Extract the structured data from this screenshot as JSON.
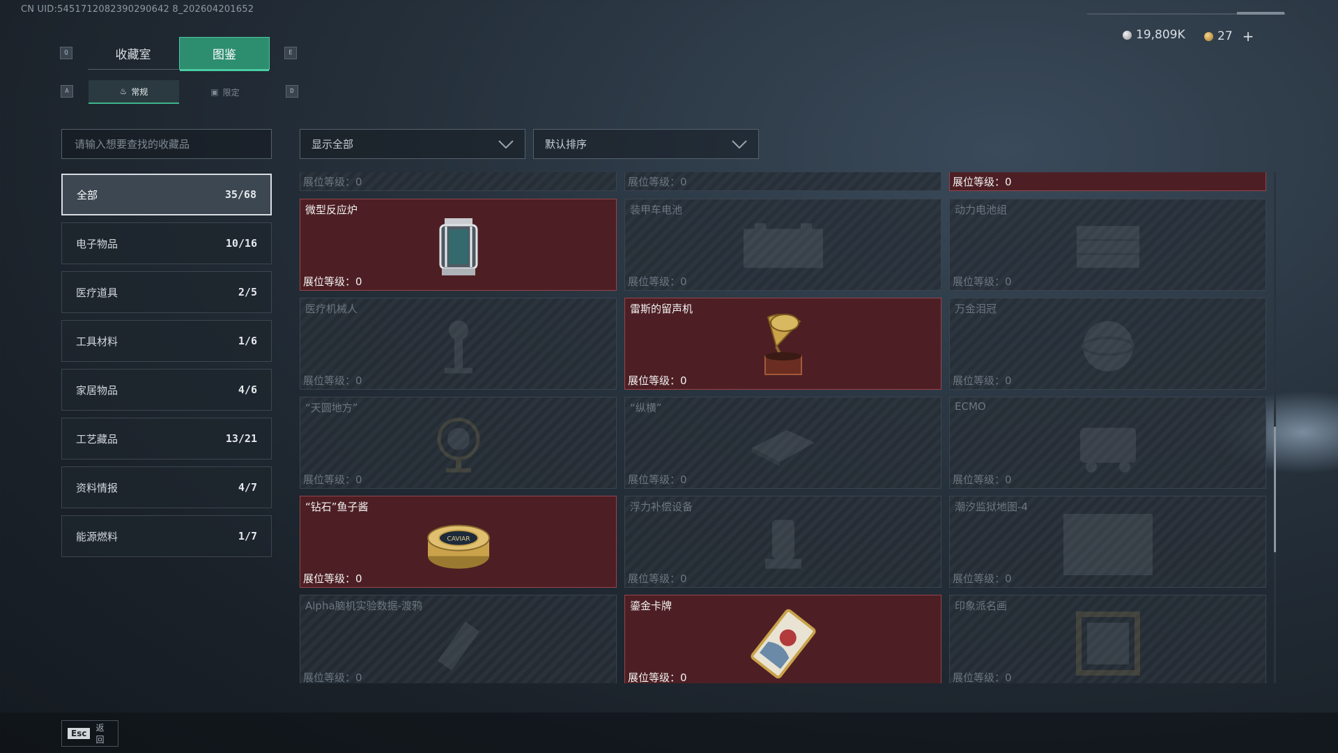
{
  "header": {
    "uid": "CN UID:5451712082390290642 8_202604201652",
    "keys": {
      "left_main": "Q",
      "right_main": "E",
      "left_sub": "A",
      "right_sub": "D"
    },
    "tabs": [
      {
        "label": "收藏室"
      },
      {
        "label": "图鉴"
      }
    ],
    "subtabs": [
      {
        "label": "常规"
      },
      {
        "label": "限定"
      }
    ],
    "currency": {
      "silver": "19,809K",
      "gold": "27"
    }
  },
  "search": {
    "placeholder": "请输入想要查找的收藏品"
  },
  "filters": {
    "show": "显示全部",
    "sort": "默认排序"
  },
  "categories": [
    {
      "label": "全部",
      "count": "35/68"
    },
    {
      "label": "电子物品",
      "count": "10/16"
    },
    {
      "label": "医疗道具",
      "count": "2/5"
    },
    {
      "label": "工具材料",
      "count": "1/6"
    },
    {
      "label": "家居物品",
      "count": "4/6"
    },
    {
      "label": "工艺藏品",
      "count": "13/21"
    },
    {
      "label": "资料情报",
      "count": "4/7"
    },
    {
      "label": "能源燃料",
      "count": "1/7"
    }
  ],
  "level_label": "展位等级：0",
  "items": [
    {
      "name": "",
      "owned": false,
      "icon": "none"
    },
    {
      "name": "",
      "owned": false,
      "icon": "none"
    },
    {
      "name": "",
      "owned": true,
      "icon": "none"
    },
    {
      "name": "微型反应炉",
      "owned": true,
      "icon": "reactor-icon"
    },
    {
      "name": "装甲车电池",
      "owned": false,
      "icon": "battery-icon"
    },
    {
      "name": "动力电池组",
      "owned": false,
      "icon": "battery-pack-icon"
    },
    {
      "name": "医疗机械人",
      "owned": false,
      "icon": "robot-icon"
    },
    {
      "name": "雷斯的留声机",
      "owned": true,
      "icon": "gramophone-icon"
    },
    {
      "name": "万金泪冠",
      "owned": false,
      "icon": "crown-icon"
    },
    {
      "name": "“天圆地方”",
      "owned": false,
      "icon": "globe-icon"
    },
    {
      "name": "“纵横”",
      "owned": false,
      "icon": "chessboard-icon"
    },
    {
      "name": "ECMO",
      "owned": false,
      "icon": "ecmo-icon"
    },
    {
      "name": "“钻石”鱼子酱",
      "owned": true,
      "icon": "caviar-icon"
    },
    {
      "name": "浮力补偿设备",
      "owned": false,
      "icon": "bcd-icon"
    },
    {
      "name": "潮汐监狱地图-4",
      "owned": false,
      "icon": "map-icon"
    },
    {
      "name": "Alpha脑机实验数据-渡鸦",
      "owned": false,
      "icon": "data-drive-icon"
    },
    {
      "name": "鎏金卡牌",
      "owned": true,
      "icon": "card-icon"
    },
    {
      "name": "印象派名画",
      "owned": false,
      "icon": "painting-icon"
    }
  ],
  "caviar_label": "CAVIAR",
  "footer": {
    "esc": "Esc",
    "back": "返回"
  },
  "colors": {
    "accent": "#2c8d6f",
    "owned_bg": "#4d1f24",
    "owned_border": "#96454b"
  }
}
